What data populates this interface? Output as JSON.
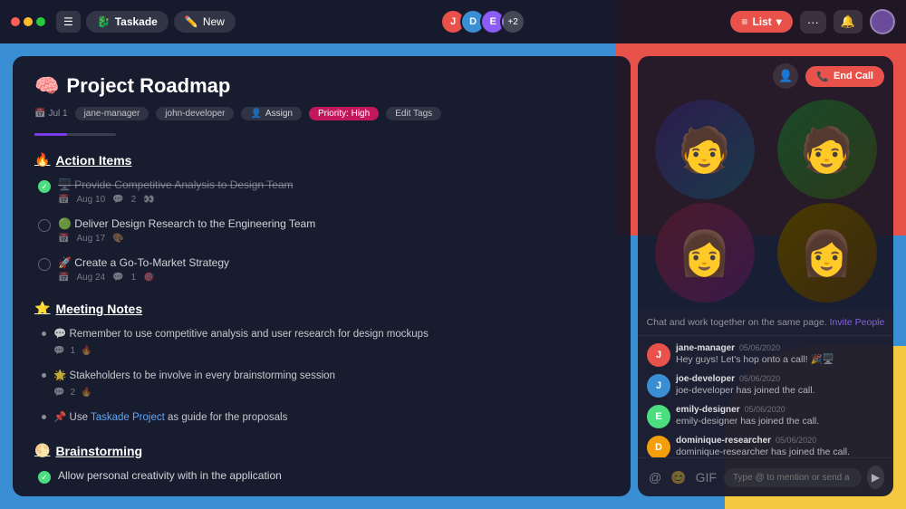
{
  "window": {
    "title": "Taskade"
  },
  "topbar": {
    "brand_label": "Taskade",
    "new_label": "New",
    "list_label": "List",
    "avatar_count": "+2",
    "dots_label": "···"
  },
  "project": {
    "emoji": "🧠",
    "title": "Project Roadmap",
    "date": "Jul 1",
    "tag1": "jane-manager",
    "tag2": "john-developer",
    "assign_label": "Assign",
    "priority_label": "Priority: High",
    "edit_tags_label": "Edit Tags"
  },
  "action_items": {
    "emoji": "🔥",
    "heading": "Action Items",
    "tasks": [
      {
        "id": 1,
        "done": true,
        "emoji": "🖥️",
        "title": "Provide Competitive Analysis to Design Team",
        "date": "Aug 10",
        "comments": "2",
        "reaction_emoji": "👀"
      },
      {
        "id": 2,
        "done": false,
        "emoji": "🟢",
        "title": "Deliver Design Research to the Engineering Team",
        "date": "Aug 17",
        "reaction_emoji": "🎨"
      },
      {
        "id": 3,
        "done": false,
        "emoji": "🚀",
        "title": "Create a Go-To-Market Strategy",
        "date": "Aug 24",
        "comments": "1",
        "reaction_emoji": "🎯"
      }
    ]
  },
  "meeting_notes": {
    "emoji": "⭐",
    "heading": "Meeting Notes",
    "bullets": [
      {
        "id": 1,
        "emoji": "💬",
        "text": "Remember to use competitive analysis and user research for design mockups",
        "meta": "1"
      },
      {
        "id": 2,
        "emoji": "🌟",
        "text": "Stakeholders to be involve in every brainstorming session",
        "meta": "2"
      },
      {
        "id": 3,
        "emoji": "📌",
        "text": "Use Taskade Project as guide for the proposals",
        "link_text": "Taskade Project",
        "link_pos": "4"
      }
    ]
  },
  "brainstorming": {
    "emoji": "🌕",
    "heading": "Brainstorming",
    "tasks": [
      {
        "id": 1,
        "done": true,
        "text": "Allow personal creativity with in the application"
      }
    ]
  },
  "call": {
    "add_user_icon": "👤+",
    "end_call_label": "End Call",
    "phone_icon": "📞",
    "participants": [
      {
        "id": 1,
        "emoji": "🧑",
        "color": "#1a3a2a"
      },
      {
        "id": 2,
        "emoji": "🧑",
        "color": "#1e4020"
      },
      {
        "id": 3,
        "emoji": "👩",
        "color": "#3a1528"
      },
      {
        "id": 4,
        "emoji": "👩",
        "color": "#4a3a00"
      }
    ]
  },
  "chat": {
    "invite_text": "Chat and work together on the same page.",
    "invite_link": "Invite People",
    "messages": [
      {
        "id": 1,
        "username": "jane-manager",
        "time": "05/06/2020",
        "text": "Hey guys! Let's hop onto a call! 🎉🖥️",
        "avatar_initial": "J",
        "avatar_color": "#e8524a"
      },
      {
        "id": 2,
        "username": "joe-developer",
        "time": "05/06/2020",
        "text": "joe-developer has joined the call.",
        "avatar_initial": "J",
        "avatar_color": "#3a8fd4"
      },
      {
        "id": 3,
        "username": "emily-designer",
        "time": "05/06/2020",
        "text": "emily-designer has joined the call.",
        "avatar_initial": "E",
        "avatar_color": "#4ade80"
      },
      {
        "id": 4,
        "username": "dominique-researcher",
        "time": "05/06/2020",
        "text": "dominique-researcher has joined the call.",
        "avatar_initial": "D",
        "avatar_color": "#f59e0b"
      }
    ],
    "input_placeholder": "Type @ to mention or send a message",
    "at_icon": "@",
    "emoji_icon": "😊",
    "gif_icon": "GIF",
    "send_icon": "▶"
  }
}
